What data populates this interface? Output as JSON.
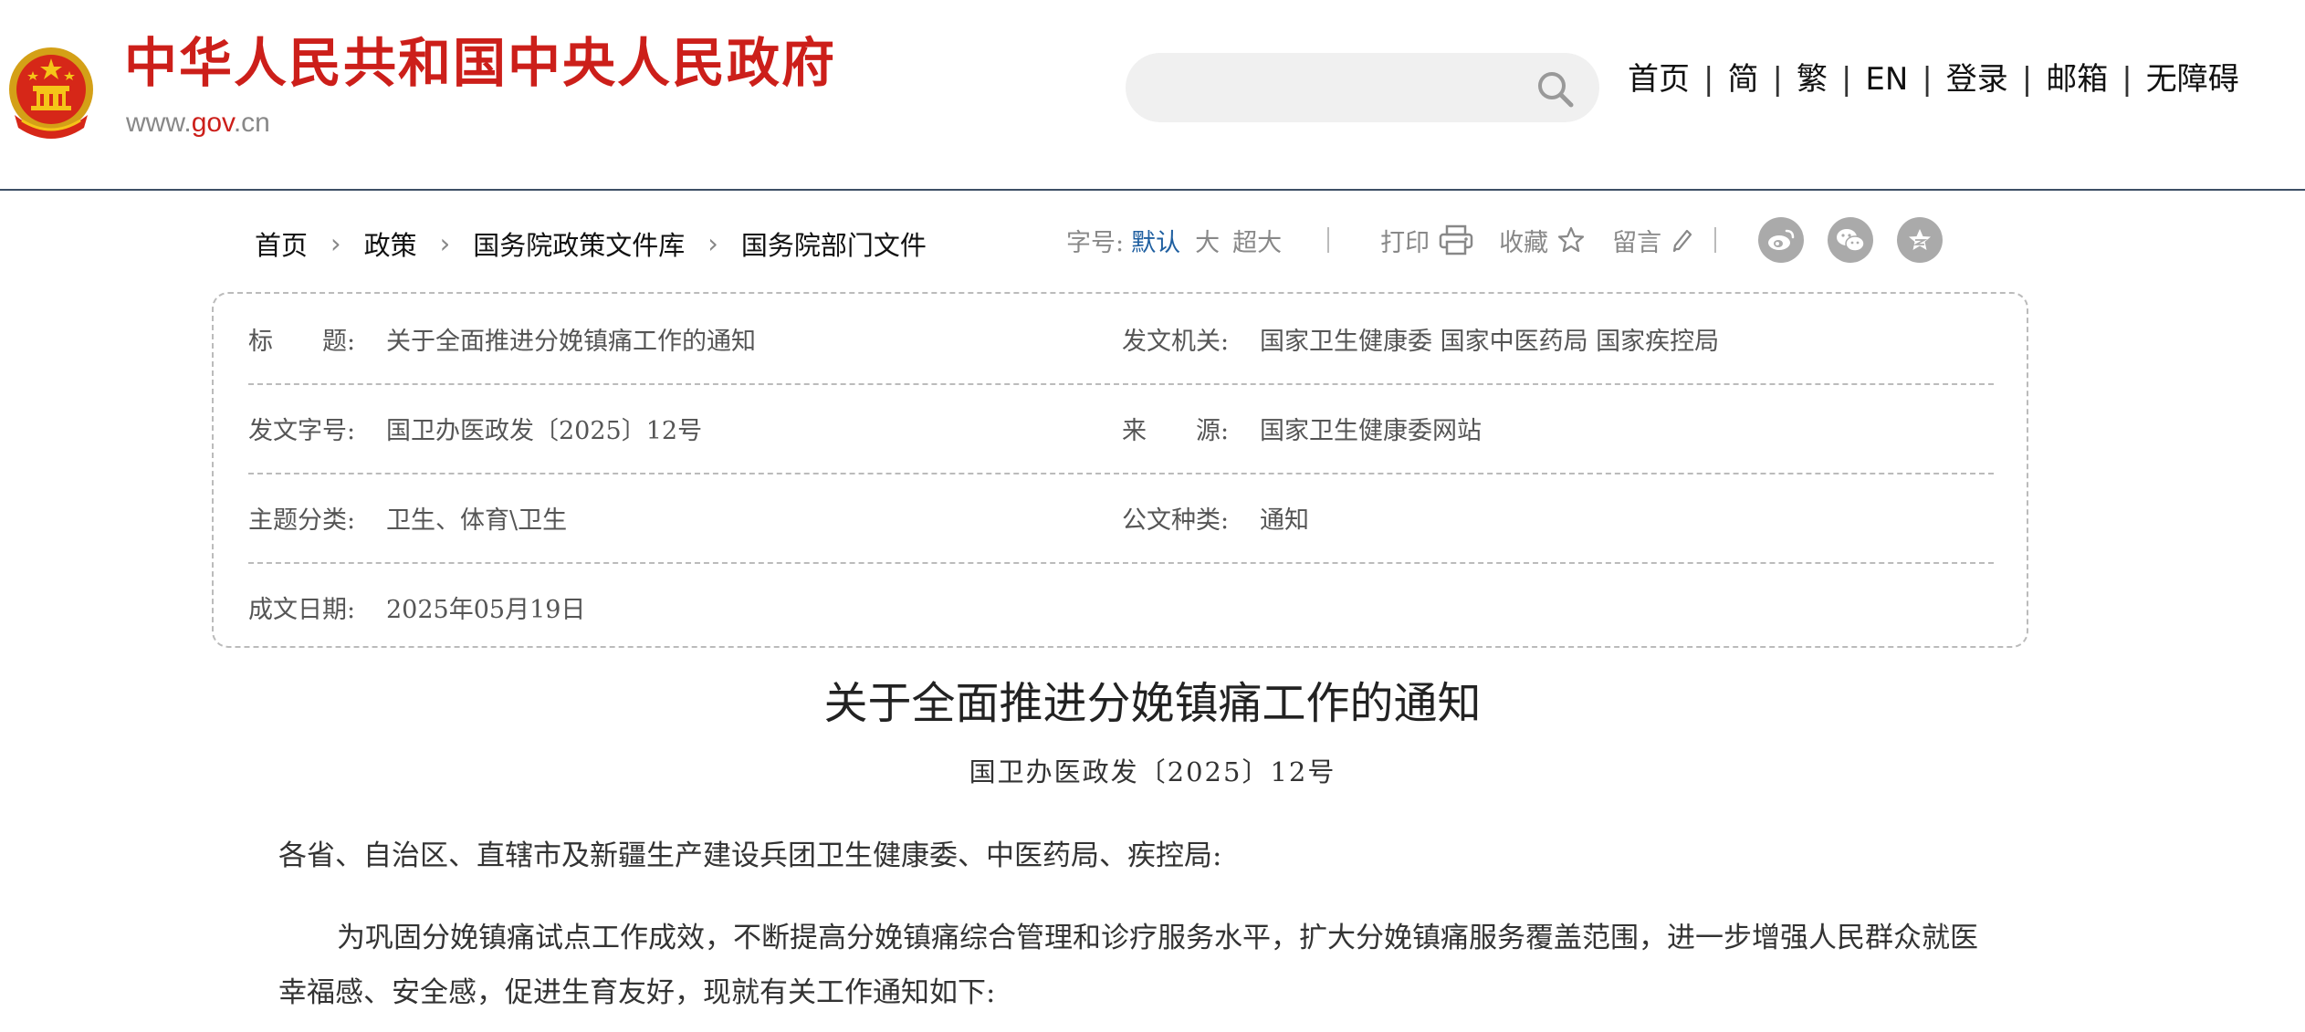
{
  "header": {
    "site_title": "中华人民共和国中央人民政府",
    "site_url_prefix": "www.",
    "site_url_mid": "gov",
    "site_url_suffix": ".cn",
    "search": {
      "placeholder": ""
    },
    "nav": [
      {
        "label": "首页"
      },
      {
        "label": "简"
      },
      {
        "label": "繁"
      },
      {
        "label": "EN"
      },
      {
        "label": "登录"
      },
      {
        "label": "邮箱"
      },
      {
        "label": "无障碍"
      }
    ],
    "nav_separator": "|"
  },
  "breadcrumb": [
    {
      "label": "首页"
    },
    {
      "label": "政策"
    },
    {
      "label": "国务院政策文件库"
    },
    {
      "label": "国务院部门文件"
    }
  ],
  "toolbar": {
    "font_size_label": "字号:",
    "font_default": "默认",
    "font_large": "大",
    "font_xlarge": "超大",
    "print": "打印",
    "favorite": "收藏",
    "comment": "留言",
    "share_icons": [
      "weibo-icon",
      "wechat-icon",
      "qzone-icon"
    ]
  },
  "info": {
    "title_label": "标　　题:",
    "title_value": "关于全面推进分娩镇痛工作的通知",
    "issuer_label": "发文机关:",
    "issuer_value": "国家卫生健康委 国家中医药局 国家疾控局",
    "doc_no_label": "发文字号:",
    "doc_no_value": "国卫办医政发〔2025〕12号",
    "source_label": "来　　源:",
    "source_value": "国家卫生健康委网站",
    "topic_label": "主题分类:",
    "topic_value": "卫生、体育\\卫生",
    "type_label": "公文种类:",
    "type_value": "通知",
    "date_label": "成文日期:",
    "date_value": "2025年05月19日"
  },
  "article": {
    "title": "关于全面推进分娩镇痛工作的通知",
    "doc_number": "国卫办医政发〔2025〕12号",
    "salutation": "各省、自治区、直辖市及新疆生产建设兵团卫生健康委、中医药局、疾控局:",
    "paragraph1": "为巩固分娩镇痛试点工作成效，不断提高分娩镇痛综合管理和诊疗服务水平，扩大分娩镇痛服务覆盖范围，进一步增强人民群众就医幸福感、安全感，促进生育友好，现就有关工作通知如下:"
  },
  "colors": {
    "brand_red": "#cc1f1a",
    "accent_blue": "#1f5fa0",
    "header_rule": "#3d4f66",
    "dashed_border": "#bbbbbb"
  }
}
